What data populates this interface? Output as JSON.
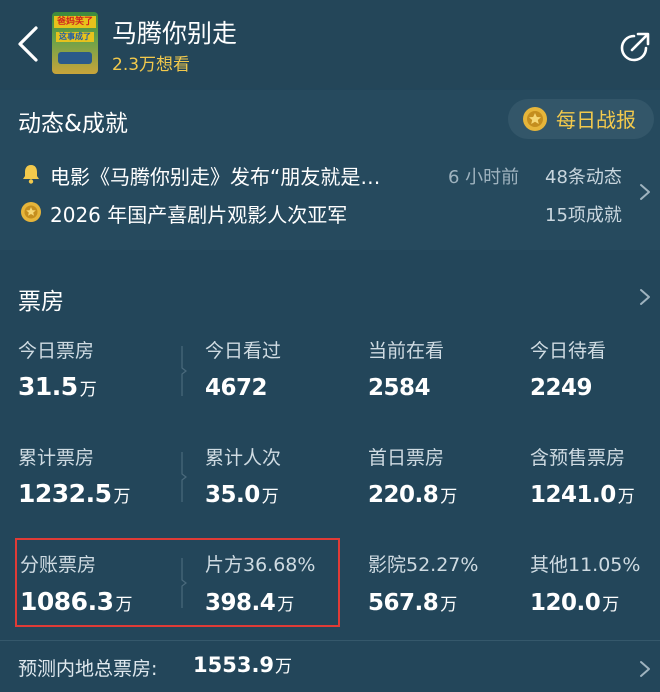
{
  "header": {
    "title": "马腾你别走",
    "want_count": "2.3万想看",
    "poster_text_top": "爸妈笑了",
    "poster_text_bottom": "这事成了"
  },
  "news": {
    "section_title": "动态&成就",
    "daily_button": "每日战报",
    "item1_text": "电影《马腾你别走》发布“朋友就是…",
    "item1_time": "6 小时前",
    "item1_count": "48条动态",
    "item2_text": "2026 年国产喜剧片观影人次亚军",
    "item2_count": "15项成就"
  },
  "box_office": {
    "section_title": "票房",
    "today_box_label": "今日票房",
    "today_box_value": "31.5",
    "today_box_unit": "万",
    "today_seen_label": "今日看过",
    "today_seen_value": "4672",
    "now_watching_label": "当前在看",
    "now_watching_value": "2584",
    "today_pending_label": "今日待看",
    "today_pending_value": "2249",
    "total_box_label": "累计票房",
    "total_box_value": "1232.5",
    "total_box_unit": "万",
    "total_viewers_label": "累计人次",
    "total_viewers_value": "35.0",
    "total_viewers_unit": "万",
    "first_day_label": "首日票房",
    "first_day_value": "220.8",
    "first_day_unit": "万",
    "presale_label": "含预售票房",
    "presale_value": "1241.0",
    "presale_unit": "万",
    "split_label": "分账票房",
    "split_value": "1086.3",
    "split_unit": "万",
    "producer_label": "片方36.68%",
    "producer_value": "398.4",
    "producer_unit": "万",
    "cinema_label": "影院52.27%",
    "cinema_value": "567.8",
    "cinema_unit": "万",
    "other_label": "其他11.05%",
    "other_value": "120.0",
    "other_unit": "万",
    "forecast_label": "预测内地总票房:",
    "forecast_value": "1553.9",
    "forecast_unit": "万"
  },
  "colors": {
    "background": "#23465a",
    "accent_gold": "#f2c94c",
    "highlight_red": "#e03b36"
  },
  "icons": [
    "back-arrow-icon",
    "share-icon",
    "bell-icon",
    "medal-icon",
    "chevron-right-icon"
  ]
}
